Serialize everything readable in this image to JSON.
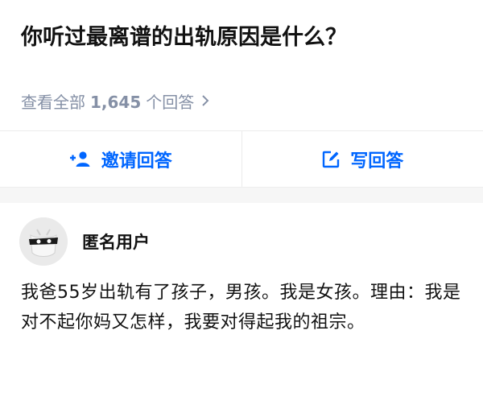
{
  "question": {
    "title": "你听过最离谱的出轨原因是什么？",
    "view_all_prefix": "查看全部",
    "answer_count": "1,645",
    "view_all_suffix": "个回答",
    "chevron_icon": "chevron-right-icon"
  },
  "actions": {
    "invite_label": "邀请回答",
    "invite_icon": "add-user-icon",
    "write_label": "写回答",
    "write_icon": "edit-icon",
    "accent_color": "#0066ff"
  },
  "answer": {
    "author_name": "匿名用户",
    "avatar_icon": "anonymous-avatar-icon",
    "text": "我爸55岁出轨有了孩子，男孩。我是女孩。理由：我是对不起你妈又怎样，我要对得起我的祖宗。"
  }
}
